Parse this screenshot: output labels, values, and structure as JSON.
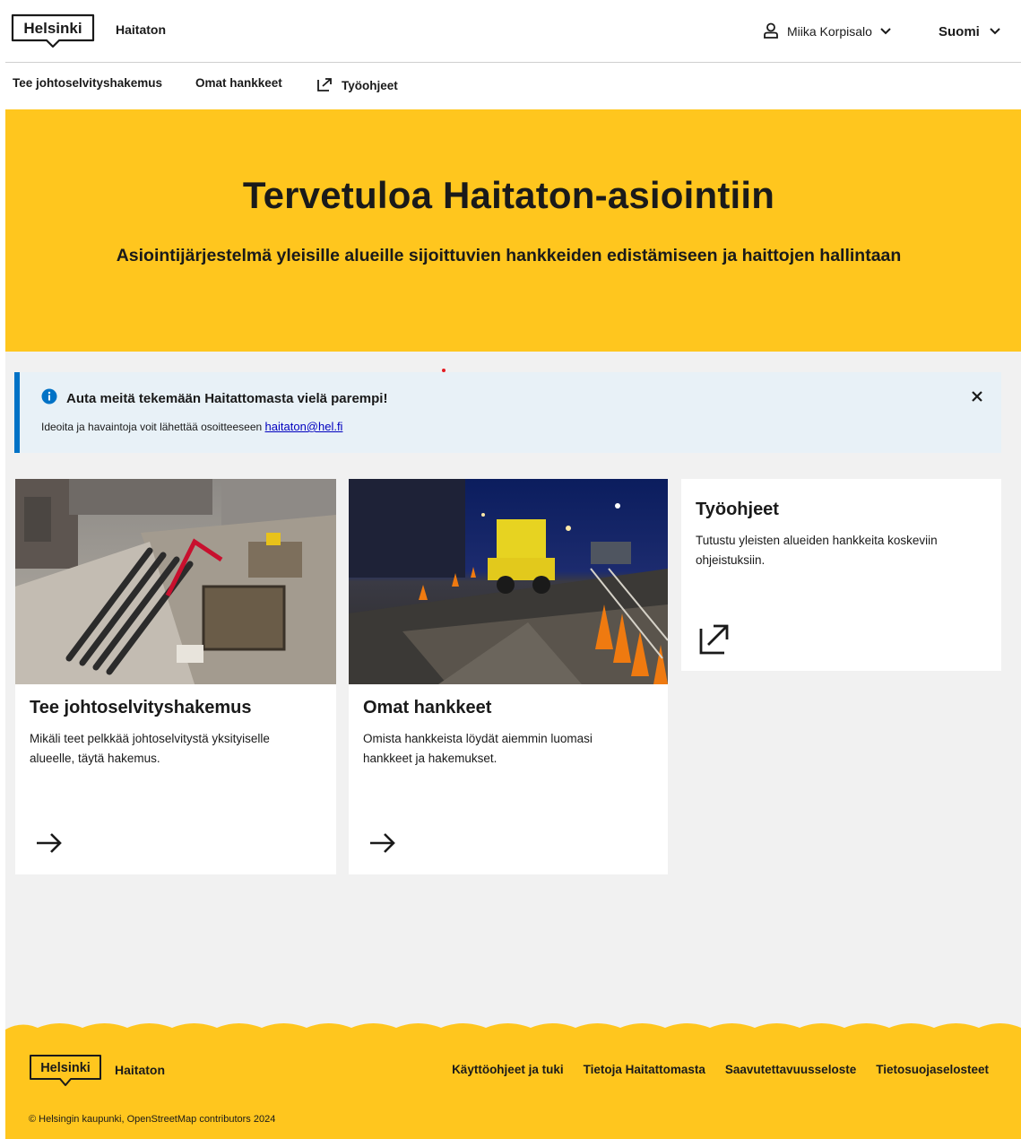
{
  "header": {
    "brand": "Helsinki",
    "app_name": "Haitaton",
    "user_name": "Miika Korpisalo",
    "language": "Suomi"
  },
  "nav": {
    "items": [
      {
        "label": "Tee johtoselvityshakemus"
      },
      {
        "label": "Omat hankkeet"
      },
      {
        "label": "Työohjeet"
      }
    ]
  },
  "hero": {
    "title": "Tervetuloa Haitaton-asiointiin",
    "subtitle": "Asiointijärjestelmä yleisille alueille sijoittuvien hankkeiden edistämiseen ja haittojen hallintaan"
  },
  "notification": {
    "title": "Auta meitä tekemään Haitattomasta vielä parempi!",
    "text": "Ideoita ja havaintoja voit lähettää osoitteeseen",
    "email": "haitaton@hel.fi"
  },
  "cards": [
    {
      "title": "Tee johtoselvityshakemus",
      "description": "Mikäli teet pelkkää johtoselvitystä yksityiselle alueelle, täytä hakemus."
    },
    {
      "title": "Omat hankkeet",
      "description": "Omista hankkeista löydät aiemmin luomasi hankkeet ja hakemukset."
    },
    {
      "title": "Työohjeet",
      "description": "Tutustu yleisten alueiden hankkeita koskeviin ohjeistuksiin."
    }
  ],
  "footer": {
    "brand": "Helsinki",
    "app_name": "Haitaton",
    "links": [
      {
        "label": "Käyttöohjeet ja tuki"
      },
      {
        "label": "Tietoja Haitattomasta"
      },
      {
        "label": "Saavutettavuusseloste"
      },
      {
        "label": "Tietosuojaselosteet"
      }
    ],
    "copyright": "© Helsingin kaupunki, OpenStreetMap contributors 2024"
  },
  "colors": {
    "brand_yellow": "#ffc61e",
    "info_blue": "#0072c6",
    "info_bg": "#e8f1f7",
    "link": "#0000bf"
  }
}
